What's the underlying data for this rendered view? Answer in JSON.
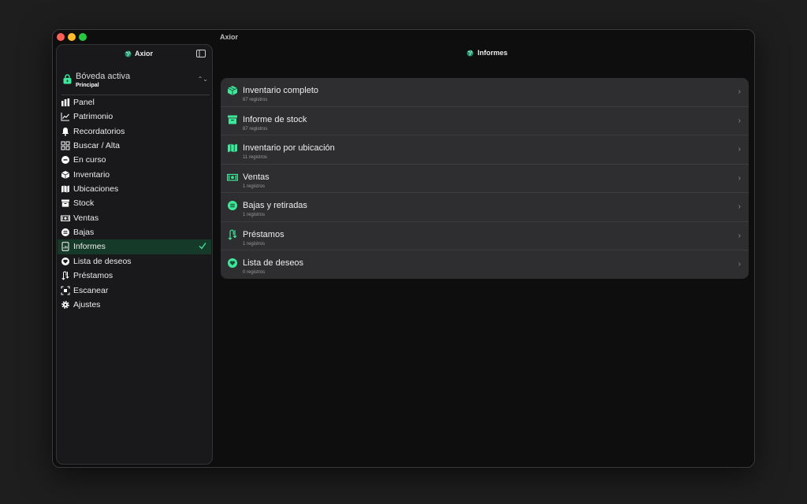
{
  "window": {
    "title": "Axior"
  },
  "sidebar": {
    "title": "Axior",
    "vault": {
      "title": "Bóveda activa",
      "subtitle": "Principal"
    },
    "items": [
      {
        "label": "Panel",
        "icon": "chart-bar-icon"
      },
      {
        "label": "Patrimonio",
        "icon": "trend-line-icon"
      },
      {
        "label": "Recordatorios",
        "icon": "bell-icon"
      },
      {
        "label": "Buscar / Alta",
        "icon": "grid-icon"
      },
      {
        "label": "En curso",
        "icon": "progress-circle-icon"
      },
      {
        "label": "Inventario",
        "icon": "box-icon"
      },
      {
        "label": "Ubicaciones",
        "icon": "map-icon"
      },
      {
        "label": "Stock",
        "icon": "archive-icon"
      },
      {
        "label": "Ventas",
        "icon": "banknote-icon"
      },
      {
        "label": "Bajas",
        "icon": "coin-stack-icon"
      },
      {
        "label": "Informes",
        "icon": "report-icon",
        "active": true
      },
      {
        "label": "Lista de deseos",
        "icon": "heart-icon"
      },
      {
        "label": "Préstamos",
        "icon": "loan-arrows-icon"
      },
      {
        "label": "Escanear",
        "icon": "scan-icon"
      },
      {
        "label": "Ajustes",
        "icon": "gear-icon"
      }
    ]
  },
  "main": {
    "title": "Informes",
    "reports": [
      {
        "name": "Inventario completo",
        "count": "87 registros",
        "icon": "box-icon"
      },
      {
        "name": "Informe de stock",
        "count": "87 registros",
        "icon": "archive-icon"
      },
      {
        "name": "Inventario por ubicación",
        "count": "11 registros",
        "icon": "map-icon"
      },
      {
        "name": "Ventas",
        "count": "1 registros",
        "icon": "banknote-icon"
      },
      {
        "name": "Bajas y retiradas",
        "count": "1 registros",
        "icon": "coin-stack-icon"
      },
      {
        "name": "Préstamos",
        "count": "1 registros",
        "icon": "loan-arrows-icon"
      },
      {
        "name": "Lista de deseos",
        "count": "0 registros",
        "icon": "heart-icon"
      }
    ]
  },
  "colors": {
    "accent": "#3ee89a",
    "active_bg": "#163a2a",
    "card_bg": "#2e2e30"
  }
}
